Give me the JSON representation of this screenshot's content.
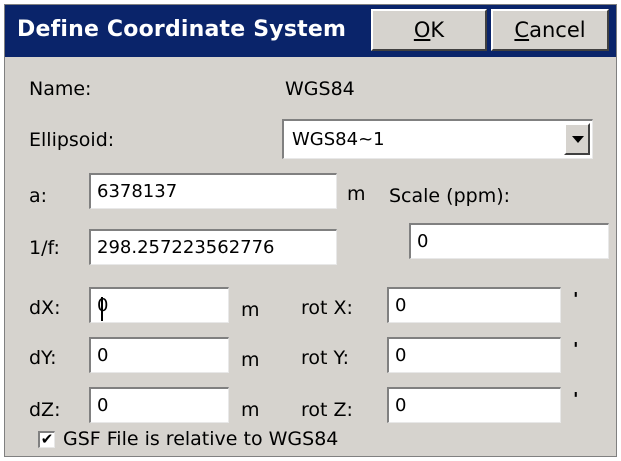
{
  "dialog": {
    "title": "Define Coordinate System",
    "ok_label": "OK",
    "ok_mnemonic": "O",
    "ok_rest": "K",
    "cancel_label": "Cancel",
    "cancel_mnemonic": "C",
    "cancel_rest": "ancel"
  },
  "name": {
    "label": "Name:",
    "value": "WGS84"
  },
  "ellipsoid": {
    "label": "Ellipsoid:",
    "value": "WGS84~1"
  },
  "a": {
    "label": "a:",
    "value": "6378137",
    "unit": "m"
  },
  "inv_f": {
    "label": "1/f:",
    "value": "298.257223562776"
  },
  "scale": {
    "label": "Scale (ppm):",
    "value": "0"
  },
  "dx": {
    "label": "dX:",
    "value": "0",
    "unit": "m"
  },
  "dy": {
    "label": "dY:",
    "value": "0",
    "unit": "m"
  },
  "dz": {
    "label": "dZ:",
    "value": "0",
    "unit": "m"
  },
  "rot_x": {
    "label": "rot X:",
    "value": "0",
    "unit": "'"
  },
  "rot_y": {
    "label": "rot Y:",
    "value": "0",
    "unit": "'"
  },
  "rot_z": {
    "label": "rot Z:",
    "value": "0",
    "unit": "'"
  },
  "gsf": {
    "label": "GSF File is relative to WGS84",
    "checked": true,
    "mark": "✔"
  },
  "colors": {
    "titlebar": "#0a246a",
    "dialog_bg": "#d6d3ce",
    "field_bg": "#ffffff"
  },
  "icons": {
    "dropdown": "chevron-down-icon",
    "check": "checkmark-icon"
  }
}
